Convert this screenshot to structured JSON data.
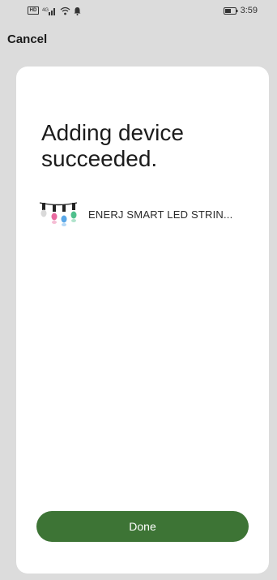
{
  "status_bar": {
    "network_label": "4G",
    "time": "3:59",
    "icons": [
      "hd-icon",
      "signal-icon",
      "wifi-icon",
      "notification-icon",
      "battery-icon"
    ]
  },
  "header": {
    "cancel_label": "Cancel"
  },
  "card": {
    "headline": "Adding device succeeded.",
    "device": {
      "name": "ENERJ SMART LED STRIN...",
      "icon": "led-string-lights-icon"
    },
    "done_label": "Done"
  },
  "colors": {
    "background": "#dcdcdc",
    "card": "#ffffff",
    "primary_button": "#3d7435",
    "bulb_pink": "#e86aa0",
    "bulb_blue": "#5aa8e8",
    "bulb_green": "#4fc08d"
  }
}
